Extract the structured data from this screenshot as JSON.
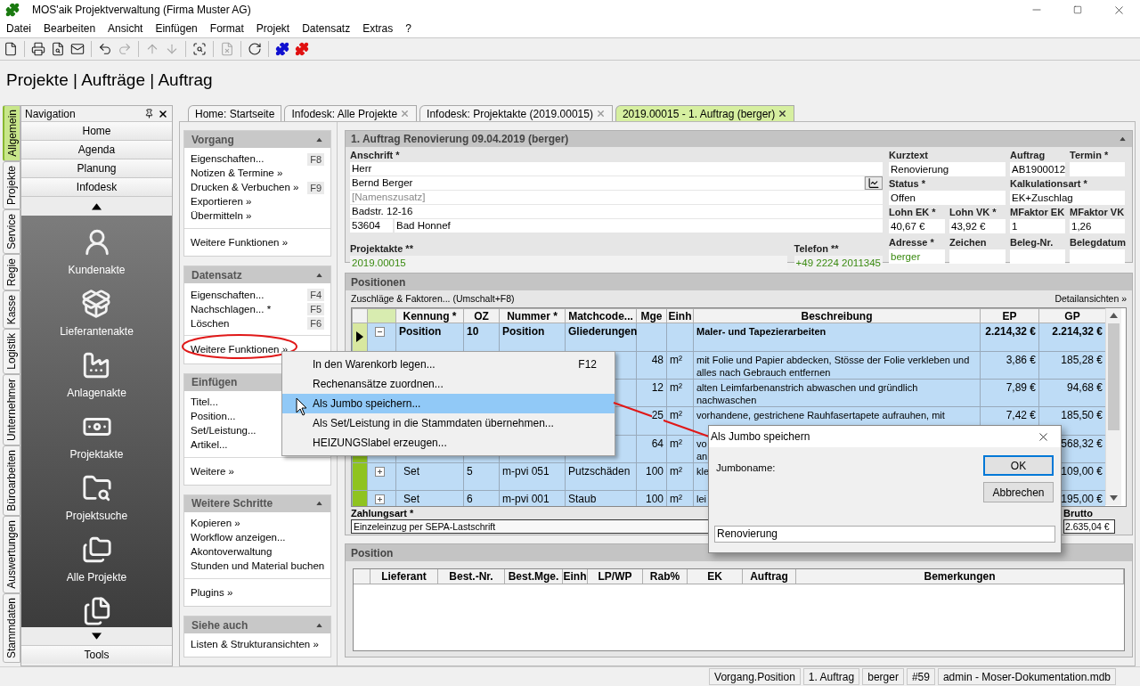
{
  "window": {
    "title": "MOS'aik Projektverwaltung (Firma Muster AG)"
  },
  "menu": [
    "Datei",
    "Bearbeiten",
    "Ansicht",
    "Einfügen",
    "Format",
    "Projekt",
    "Datensatz",
    "Extras",
    "?"
  ],
  "toolbar": [
    {
      "disabled": false
    },
    {
      "disabled": false
    },
    {
      "disabled": false
    },
    {
      "disabled": false
    },
    {
      "disabled": false
    },
    {
      "disabled": true
    },
    {
      "disabled": true
    },
    {
      "disabled": true
    },
    {
      "disabled": false
    },
    {
      "disabled": true
    },
    {
      "disabled": false
    },
    {
      "disabled": false
    },
    {
      "disabled": false
    }
  ],
  "breadcrumb": "Projekte | Aufträge | Auftrag",
  "side_tabs": [
    {
      "label": "Allgemein",
      "selected": true
    },
    {
      "label": "Projekte",
      "selected": false
    },
    {
      "label": "Service",
      "selected": false
    },
    {
      "label": "Regie",
      "selected": false
    },
    {
      "label": "Kasse",
      "selected": false
    },
    {
      "label": "Logistik",
      "selected": false
    },
    {
      "label": "Unternehmer",
      "selected": false
    },
    {
      "label": "Büroarbeiten",
      "selected": false
    },
    {
      "label": "Auswertungen",
      "selected": false
    },
    {
      "label": "Stammdaten",
      "selected": false
    }
  ],
  "navigation": {
    "title": "Navigation",
    "items": [
      "Home",
      "Agenda",
      "Planung",
      "Infodesk"
    ],
    "launchers": [
      {
        "label": "Kundenakte"
      },
      {
        "label": "Lieferantenakte"
      },
      {
        "label": "Anlagenakte"
      },
      {
        "label": "Projektakte"
      },
      {
        "label": "Projektsuche"
      },
      {
        "label": "Alle Projekte"
      }
    ],
    "footer": "Tools"
  },
  "doc_tabs": [
    {
      "label": "Home: Startseite",
      "selected": false,
      "closable": false
    },
    {
      "label": "Infodesk: Alle Projekte",
      "selected": false,
      "closable": true
    },
    {
      "label": "Infodesk: Projektakte (2019.00015)",
      "selected": false,
      "closable": true
    },
    {
      "label": "2019.00015 - 1. Auftrag (berger)",
      "selected": true,
      "closable": true
    }
  ],
  "task_sections": [
    {
      "title": "Vorgang",
      "items": [
        {
          "label": "Eigenschaften...",
          "shortcut": "F8"
        },
        {
          "label": "Notizen & Termine »"
        },
        {
          "label": "Drucken & Verbuchen »",
          "shortcut": "F9"
        },
        {
          "label": "Exportieren »"
        },
        {
          "label": "Übermitteln »"
        }
      ],
      "more": {
        "label": "Weitere Funktionen »",
        "circled": false
      }
    },
    {
      "title": "Datensatz",
      "items": [
        {
          "label": "Eigenschaften...",
          "shortcut": "F4"
        },
        {
          "label": "Nachschlagen... *",
          "shortcut": "F5"
        },
        {
          "label": "Löschen",
          "shortcut": "F6"
        }
      ],
      "more": {
        "label": "Weitere Funktionen »",
        "circled": true
      }
    },
    {
      "title": "Einfügen",
      "items": [
        {
          "label": "Titel..."
        },
        {
          "label": "Position..."
        },
        {
          "label": "Set/Leistung..."
        },
        {
          "label": "Artikel..."
        }
      ],
      "more": {
        "label": "Weitere »",
        "circled": false
      }
    },
    {
      "title": "Weitere Schritte",
      "items": [
        {
          "label": "Kopieren »"
        },
        {
          "label": "Workflow anzeigen..."
        },
        {
          "label": "Akontoverwaltung"
        },
        {
          "label": "Stunden und Material buchen"
        }
      ],
      "more": {
        "label": "Plugins »",
        "circled": false
      }
    },
    {
      "title": "Siehe auch",
      "items": [
        {
          "label": "Listen & Strukturansichten »"
        }
      ]
    }
  ],
  "form": {
    "title": "1. Auftrag Renovierung 09.04.2019 (berger)",
    "address": {
      "label": "Anschrift *",
      "lines": [
        {
          "value": "Herr"
        },
        {
          "value": "Bernd Berger",
          "button": true
        },
        {
          "placeholder": "[Namenszusatz]"
        },
        {
          "value": "Badstr. 12-16"
        }
      ],
      "zip": "53604",
      "city": "Bad Honnef"
    },
    "projektakte": {
      "label": "Projektakte **",
      "value": "2019.00015"
    },
    "telefon": {
      "label": "Telefon **",
      "value": "+49 2224 2011345"
    },
    "fields": [
      [
        {
          "label": "Kurztext",
          "value": "Renovierung"
        },
        {
          "label": "Auftrag",
          "value": "AB1900012"
        },
        {
          "label": "Termin *"
        }
      ],
      [
        {
          "label": "Status *",
          "value": "Offen"
        },
        {
          "label": "Kalkulationsart *",
          "value": "EK+Zuschlag"
        }
      ],
      [
        {
          "label": "Lohn EK *",
          "value": "40,67 €"
        },
        {
          "label": "Lohn VK *",
          "value": "43,92 €"
        },
        {
          "label": "MFaktor EK",
          "value": "1"
        },
        {
          "label": "MFaktor VK",
          "value": "1,26"
        }
      ],
      [
        {
          "label": "Adresse *",
          "value": "berger",
          "link": true
        },
        {
          "label": "Zeichen"
        },
        {
          "label": "Beleg-Nr."
        },
        {
          "label": "Belegdatum"
        }
      ]
    ]
  },
  "positionen": {
    "title": "Positionen",
    "action": "Zuschläge & Faktoren... (Umschalt+F8)",
    "details": "Detailansichten »",
    "columns": [
      "Kennung *",
      "OZ",
      "Nummer *",
      "Matchcode...",
      "Mge",
      "Einh",
      "Beschreibung",
      "EP",
      "GP"
    ],
    "rows": [
      {
        "kind": "group",
        "current": true,
        "selected": true,
        "expanded": true,
        "kennung": "Position",
        "oz": "10",
        "nummer": "Position",
        "matchcode": "Gliederungen",
        "beschreibung": "Maler- und Tapezierarbeiten",
        "ep": "2.214,32 €",
        "gp": "2.214,32 €"
      },
      {
        "kind": "item",
        "current": false,
        "selected": true,
        "mge": "48",
        "einh": "m²",
        "beschreibung": "mit Folie und Papier abdecken, Stösse der Folie verkleben und alles nach Gebrauch entfernen",
        "ep": "3,86 €",
        "gp": "185,28 €"
      },
      {
        "kind": "item",
        "current": false,
        "selected": true,
        "mge": "12",
        "einh": "m²",
        "beschreibung": "alten Leimfarbenanstrich abwaschen und gründlich nachwaschen",
        "ep": "7,89 €",
        "gp": "94,68 €"
      },
      {
        "kind": "item",
        "current": false,
        "selected": true,
        "mge": "25",
        "einh": "m²",
        "beschreibung": "vorhandene, gestrichene Rauhfasertapete aufrauhen, mit",
        "ep": "7,42 €",
        "gp": "185,50 €"
      },
      {
        "kind": "item",
        "current": false,
        "selected": true,
        "mge": "64",
        "einh": "m²",
        "beschreibung": "vo\nan",
        "gp": "568,32 €"
      },
      {
        "kind": "set",
        "current": false,
        "selected": true,
        "expanded": false,
        "kennung": "Set",
        "oz": "5",
        "nummer": "m-pvi 051",
        "matchcode": "Putzschäden",
        "mge": "100",
        "einh": "m²",
        "beschreibung": "kle",
        "gp": "109,00 €"
      },
      {
        "kind": "set",
        "current": false,
        "selected": true,
        "expanded": false,
        "kennung": "Set",
        "oz": "6",
        "nummer": "m-pvi 001",
        "matchcode": "Staub",
        "mge": "100",
        "einh": "m²",
        "beschreibung": "lei",
        "gp": "195,00 €"
      }
    ],
    "zahlungsart": {
      "label": "Zahlungsart *",
      "value": "Einzeleinzug per SEPA-Lastschrift"
    },
    "brutto": {
      "label": "Brutto",
      "value": "2.635,04 €"
    }
  },
  "position": {
    "title": "Position",
    "columns": [
      "Lieferant",
      "Best.-Nr.",
      "Best.Mge.",
      "Einh",
      "LP/WP",
      "Rab%",
      "EK",
      "Auftrag",
      "Bemerkungen"
    ]
  },
  "context_menu": {
    "items": [
      {
        "label": "In den Warenkorb legen...",
        "shortcut": "F12",
        "selected": false
      },
      {
        "label": "Rechenansätze zuordnen...",
        "selected": false
      },
      {
        "label": "Als Jumbo speichern...",
        "selected": true
      },
      {
        "label": "Als Set/Leistung in die Stammdaten übernehmen...",
        "selected": false
      },
      {
        "label": "HEIZUNGSlabel erzeugen...",
        "selected": false
      }
    ]
  },
  "dialog": {
    "title": "Als Jumbo speichern",
    "label": "Jumboname:",
    "value": "Renovierung",
    "buttons": [
      {
        "label": "OK",
        "default": true
      },
      {
        "label": "Abbrechen",
        "default": false
      }
    ]
  },
  "status_bar": [
    "Vorgang.Position",
    "1. Auftrag",
    "berger",
    "#59",
    "admin - Moser-Dokumentation.mdb"
  ]
}
